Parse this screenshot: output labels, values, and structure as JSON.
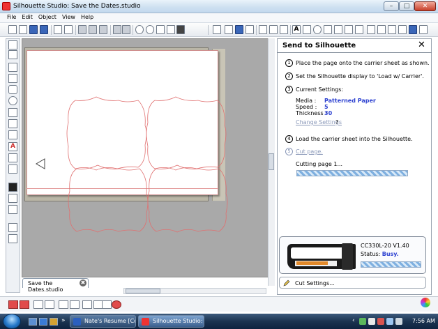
{
  "window": {
    "title": "Silhouette Studio: Save the Dates.studio",
    "minimize_label": "–",
    "maximize_label": "□",
    "close_label": "✕"
  },
  "menu": [
    "File",
    "Edit",
    "Object",
    "View",
    "Help"
  ],
  "document_tab": {
    "label": "Save the Dates.studio",
    "close_label": "✖"
  },
  "panel": {
    "title": "Send to Silhouette",
    "close_label": "✕",
    "steps": [
      {
        "num": "1",
        "text": "Place the page onto the carrier sheet as shown."
      },
      {
        "num": "2",
        "text": "Set the Silhouette display to 'Load w/ Carrier'."
      },
      {
        "num": "3",
        "text": "Current Settings:"
      },
      {
        "num": "4",
        "text": "Load the carrier sheet into the Silhouette."
      },
      {
        "num": "5",
        "text": "Cut page."
      }
    ],
    "settings": {
      "media_label": "Media :",
      "media_value": "Patterned Paper",
      "speed_label": "Speed :",
      "speed_value": "5",
      "thickness_label": "Thickness :",
      "thickness_value": "30",
      "change_link": "Change Settings",
      "change_suffix": "?"
    },
    "cutting_status": "Cutting page 1...",
    "cutting_progress": 1.0,
    "device": {
      "model": "CC330L-20 V1.40",
      "status_label": "Status:",
      "status_value": "Busy.",
      "progress": 1.0
    },
    "cut_settings_label": "Cut Settings..."
  },
  "taskbar": {
    "tasks": [
      {
        "label": "Nate's Resume [Co...",
        "active": false
      },
      {
        "label": "Silhouette Studio: S...",
        "active": true
      }
    ],
    "clock": "7:56 AM"
  },
  "colors": {
    "accent_value": "#2a3fd0",
    "cut_line": "#e07070",
    "link_dim": "#8a98b8"
  }
}
